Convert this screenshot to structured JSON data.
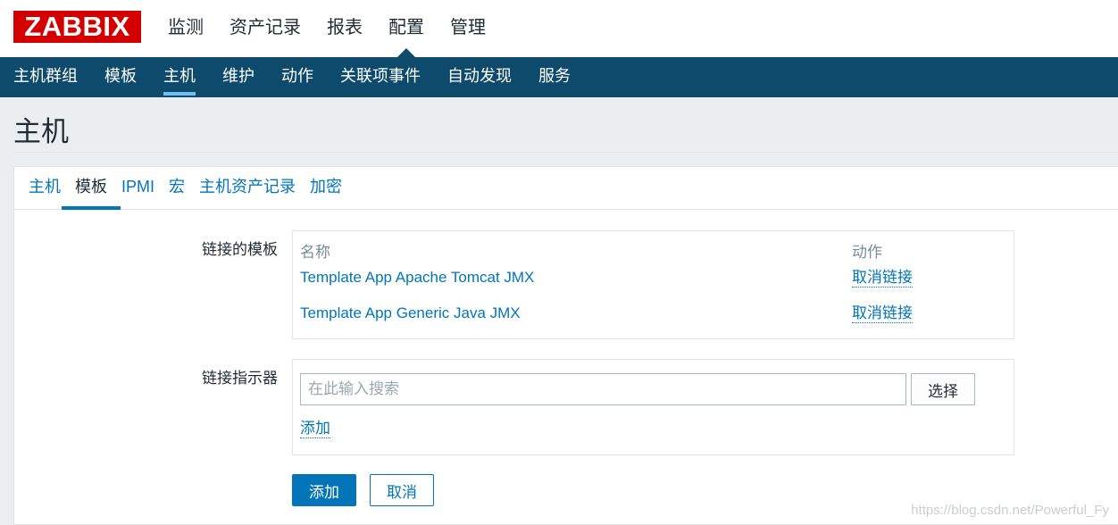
{
  "header": {
    "logo": "ZABBIX",
    "menu": [
      "监测",
      "资产记录",
      "报表",
      "配置",
      "管理"
    ],
    "active_menu": "配置"
  },
  "sub_nav": {
    "items": [
      "主机群组",
      "模板",
      "主机",
      "维护",
      "动作",
      "关联项事件",
      "自动发现",
      "服务"
    ],
    "active": "主机"
  },
  "page": {
    "title": "主机"
  },
  "tabs": {
    "items": [
      "主机",
      "模板",
      "IPMI",
      "宏",
      "主机资产记录",
      "加密"
    ],
    "active": "模板"
  },
  "linked_templates": {
    "label": "链接的模板",
    "col_name": "名称",
    "col_action": "动作",
    "rows": [
      {
        "name": "Template App Apache Tomcat JMX",
        "action": "取消链接"
      },
      {
        "name": "Template App Generic Java JMX",
        "action": "取消链接"
      }
    ]
  },
  "link_new": {
    "label": "链接指示器",
    "placeholder": "在此输入搜索",
    "select_label": "选择",
    "add_link": "添加"
  },
  "buttons": {
    "add": "添加",
    "cancel": "取消"
  },
  "watermark": "https://blog.csdn.net/Powerful_Fy",
  "colors": {
    "brand": "#d40000",
    "nav_bg": "#0e4a6b",
    "link": "#0275b8",
    "active_underline": "#6ec0f0"
  }
}
